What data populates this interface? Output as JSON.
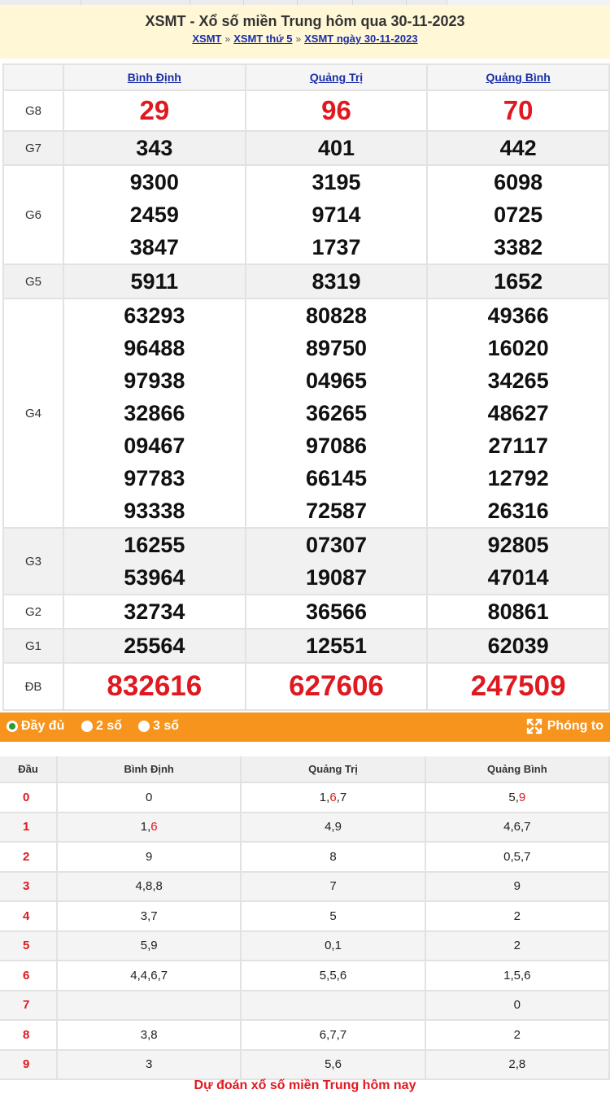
{
  "header": {
    "title": "XSMT - Xổ số miền Trung hôm qua 30-11-2023",
    "breadcrumbs": [
      "XSMT",
      "XSMT thứ 5",
      "XSMT ngày 30-11-2023"
    ],
    "separator": "»"
  },
  "provinces": [
    "Bình Định",
    "Quảng Trị",
    "Quảng Bình"
  ],
  "results": [
    {
      "label": "G8",
      "values": [
        [
          "29"
        ],
        [
          "96"
        ],
        [
          "70"
        ]
      ]
    },
    {
      "label": "G7",
      "values": [
        [
          "343"
        ],
        [
          "401"
        ],
        [
          "442"
        ]
      ]
    },
    {
      "label": "G6",
      "values": [
        [
          "9300",
          "2459",
          "3847"
        ],
        [
          "3195",
          "9714",
          "1737"
        ],
        [
          "6098",
          "0725",
          "3382"
        ]
      ]
    },
    {
      "label": "G5",
      "values": [
        [
          "5911"
        ],
        [
          "8319"
        ],
        [
          "1652"
        ]
      ]
    },
    {
      "label": "G4",
      "values": [
        [
          "63293",
          "96488",
          "97938",
          "32866",
          "09467",
          "97783",
          "93338"
        ],
        [
          "80828",
          "89750",
          "04965",
          "36265",
          "97086",
          "66145",
          "72587"
        ],
        [
          "49366",
          "16020",
          "34265",
          "48627",
          "27117",
          "12792",
          "26316"
        ]
      ]
    },
    {
      "label": "G3",
      "values": [
        [
          "16255",
          "53964"
        ],
        [
          "07307",
          "19087"
        ],
        [
          "92805",
          "47014"
        ]
      ]
    },
    {
      "label": "G2",
      "values": [
        [
          "32734"
        ],
        [
          "36566"
        ],
        [
          "80861"
        ]
      ]
    },
    {
      "label": "G1",
      "values": [
        [
          "25564"
        ],
        [
          "12551"
        ],
        [
          "62039"
        ]
      ]
    },
    {
      "label": "ĐB",
      "values": [
        [
          "832616"
        ],
        [
          "627606"
        ],
        [
          "247509"
        ]
      ]
    }
  ],
  "options": {
    "full": "Đầy đủ",
    "two_digits": "2 số",
    "three_digits": "3 số",
    "zoom": "Phóng to"
  },
  "loto": {
    "header_label": "Đầu",
    "rows": [
      {
        "head": "0",
        "cells": [
          [
            "0"
          ],
          [
            "1",
            "6*",
            "7"
          ],
          [
            "5",
            "9*"
          ]
        ]
      },
      {
        "head": "1",
        "cells": [
          [
            "1",
            "6*"
          ],
          [
            "4",
            "9"
          ],
          [
            "4",
            "6",
            "7"
          ]
        ]
      },
      {
        "head": "2",
        "cells": [
          [
            "9"
          ],
          [
            "8"
          ],
          [
            "0",
            "5",
            "7"
          ]
        ]
      },
      {
        "head": "3",
        "cells": [
          [
            "4",
            "8",
            "8"
          ],
          [
            "7"
          ],
          [
            "9"
          ]
        ]
      },
      {
        "head": "4",
        "cells": [
          [
            "3",
            "7"
          ],
          [
            "5"
          ],
          [
            "2"
          ]
        ]
      },
      {
        "head": "5",
        "cells": [
          [
            "5",
            "9"
          ],
          [
            "0",
            "1"
          ],
          [
            "2"
          ]
        ]
      },
      {
        "head": "6",
        "cells": [
          [
            "4",
            "4",
            "6",
            "7"
          ],
          [
            "5",
            "5",
            "6"
          ],
          [
            "1",
            "5",
            "6"
          ]
        ]
      },
      {
        "head": "7",
        "cells": [
          [],
          [],
          [
            "0"
          ]
        ]
      },
      {
        "head": "8",
        "cells": [
          [
            "3",
            "8"
          ],
          [
            "6",
            "7",
            "7"
          ],
          [
            "2"
          ]
        ]
      },
      {
        "head": "9",
        "cells": [
          [
            "3"
          ],
          [
            "5",
            "6"
          ],
          [
            "2",
            "8"
          ]
        ]
      }
    ]
  },
  "footer": {
    "text": "Dự đoán xổ số miền Trung hôm nay"
  },
  "colors": {
    "accent": "#f7941d",
    "prize_red": "#e0181f",
    "link": "#1a2ea8",
    "header_bg": "#fff7d6"
  }
}
